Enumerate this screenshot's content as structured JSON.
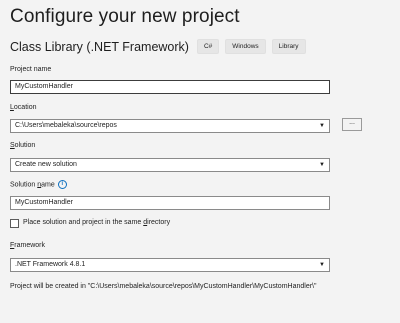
{
  "page": {
    "title": "Configure your new project"
  },
  "template": {
    "name": "Class Library (.NET Framework)",
    "tags": [
      "C#",
      "Windows",
      "Library"
    ]
  },
  "project_name": {
    "label": "Project name",
    "value": "MyCustomHandler"
  },
  "location": {
    "label_prefix": "",
    "label_accel": "L",
    "label_rest": "ocation",
    "value": "C:\\Users\\mebaleka\\source\\repos",
    "browse_label": "..."
  },
  "solution": {
    "label_accel": "S",
    "label_rest": "olution",
    "value": "Create new solution"
  },
  "solution_name": {
    "label_before": "Solution ",
    "label_accel": "n",
    "label_after": "ame",
    "info_icon_glyph": "i",
    "value": "MyCustomHandler"
  },
  "same_directory": {
    "label_before": "Place solution and project in the same ",
    "label_accel": "d",
    "label_after": "irectory",
    "checked": false
  },
  "framework": {
    "label_accel": "F",
    "label_rest": "ramework",
    "value": ".NET Framework 4.8.1"
  },
  "footer": {
    "note": "Project will be created in \"C:\\Users\\mebaleka\\source\\repos\\MyCustomHandler\\MyCustomHandler\\\""
  }
}
